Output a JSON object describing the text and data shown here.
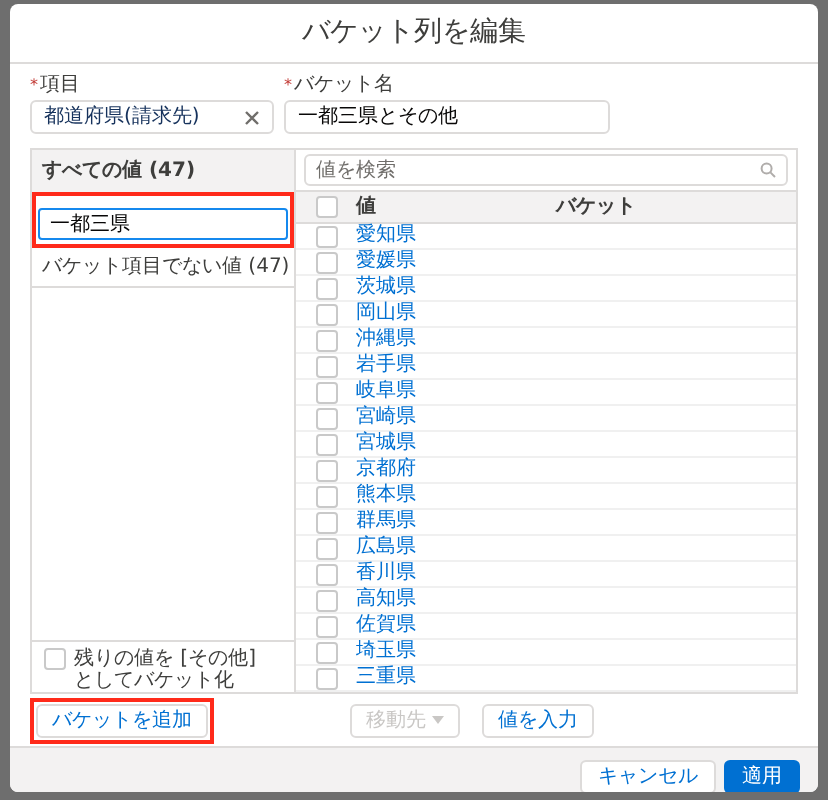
{
  "dialog": {
    "title": "バケット列を編集"
  },
  "fields": [
    {
      "label": "項目",
      "required_mark": "*",
      "value": "都道府県(請求先)",
      "clearable": true
    },
    {
      "label": "バケット名",
      "required_mark": "*",
      "value": "一都三県とその他",
      "clearable": false
    }
  ],
  "buckets": {
    "header": "すべての値 (47)",
    "items": [
      {
        "kind": "input",
        "value": "一都三県",
        "highlighted": true
      },
      {
        "kind": "item",
        "label": "バケット項目でない値 (47)",
        "highlighted": false
      }
    ]
  },
  "other_option": {
    "label": "残りの値を [その他] としてバケット化",
    "checked": false
  },
  "values": {
    "search_placeholder": "値を検索",
    "select_all_checked": false,
    "columns": [
      "値",
      "バケット"
    ],
    "rows": [
      {
        "value": "愛知県",
        "checked": false
      },
      {
        "value": "愛媛県",
        "checked": false
      },
      {
        "value": "茨城県",
        "checked": false
      },
      {
        "value": "岡山県",
        "checked": false
      },
      {
        "value": "沖縄県",
        "checked": false
      },
      {
        "value": "岩手県",
        "checked": false
      },
      {
        "value": "岐阜県",
        "checked": false
      },
      {
        "value": "宮崎県",
        "checked": false
      },
      {
        "value": "宮城県",
        "checked": false
      },
      {
        "value": "京都府",
        "checked": false
      },
      {
        "value": "熊本県",
        "checked": false
      },
      {
        "value": "群馬県",
        "checked": false
      },
      {
        "value": "広島県",
        "checked": false
      },
      {
        "value": "香川県",
        "checked": false
      },
      {
        "value": "高知県",
        "checked": false
      },
      {
        "value": "佐賀県",
        "checked": false
      },
      {
        "value": "埼玉県",
        "checked": false
      },
      {
        "value": "三重県",
        "checked": false
      }
    ]
  },
  "actions": [
    {
      "label": "バケットを追加",
      "disabled": false,
      "dropdown": false,
      "highlighted": true
    },
    {
      "label": "移動先",
      "disabled": true,
      "dropdown": true,
      "highlighted": false
    },
    {
      "label": "値を入力",
      "disabled": false,
      "dropdown": false,
      "highlighted": false
    }
  ],
  "footer": [
    {
      "label": "キャンセル",
      "primary": false
    },
    {
      "label": "適用",
      "primary": true
    }
  ]
}
